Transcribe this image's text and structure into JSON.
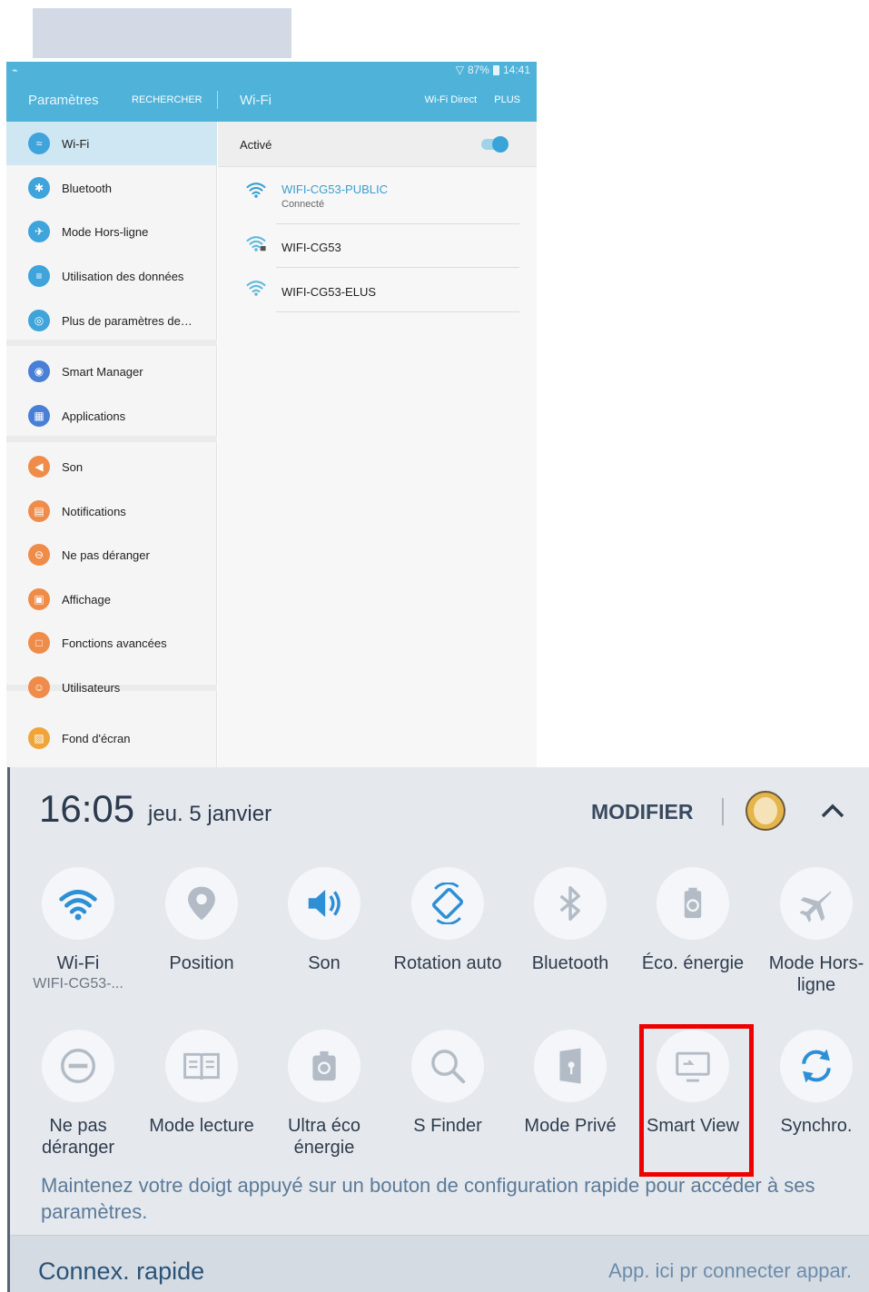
{
  "settings": {
    "status": {
      "percent": "87%",
      "time": "14:41"
    },
    "header": {
      "title": "Paramètres",
      "search": "RECHERCHER",
      "section": "Wi-Fi",
      "wifi_direct": "Wi-Fi Direct",
      "plus": "PLUS"
    },
    "sidebar": {
      "items": [
        {
          "label": "Wi-Fi",
          "icon": "wifi-icon",
          "color": "#3fa4db",
          "active": true
        },
        {
          "label": "Bluetooth",
          "icon": "bluetooth-icon",
          "color": "#3fa4db"
        },
        {
          "label": "Mode Hors-ligne",
          "icon": "airplane-icon",
          "color": "#3fa4db"
        },
        {
          "label": "Utilisation des données",
          "icon": "data-usage-icon",
          "color": "#3fa4db"
        },
        {
          "label": "Plus de paramètres de…",
          "icon": "antenna-icon",
          "color": "#3fa4db"
        },
        {
          "label": "Smart Manager",
          "icon": "smart-manager-icon",
          "color": "#4a7fd6"
        },
        {
          "label": "Applications",
          "icon": "apps-icon",
          "color": "#4a7fd6"
        },
        {
          "label": "Son",
          "icon": "sound-icon",
          "color": "#ef8c4a"
        },
        {
          "label": "Notifications",
          "icon": "notifications-icon",
          "color": "#ef8c4a"
        },
        {
          "label": "Ne pas déranger",
          "icon": "do-not-disturb-icon",
          "color": "#ef8c4a"
        },
        {
          "label": "Affichage",
          "icon": "display-icon",
          "color": "#ef8c4a"
        },
        {
          "label": "Fonctions avancées",
          "icon": "advanced-features-icon",
          "color": "#ef8c4a"
        },
        {
          "label": "Utilisateurs",
          "icon": "users-icon",
          "color": "#ef8c4a"
        },
        {
          "label": "Fond d'écran",
          "icon": "wallpaper-icon",
          "color": "#f0a53a"
        }
      ]
    },
    "wifi": {
      "toggle_label": "Activé",
      "networks": [
        {
          "name": "WIFI-CG53-PUBLIC",
          "status": "Connecté",
          "secured": false
        },
        {
          "name": "WIFI-CG53",
          "status": "",
          "secured": true
        },
        {
          "name": "WIFI-CG53-ELUS",
          "status": "",
          "secured": false
        }
      ]
    }
  },
  "quick_panel": {
    "time": "16:05",
    "date": "jeu. 5 janvier",
    "modifier": "MODIFIER",
    "tiles": [
      {
        "label": "Wi-Fi",
        "sub": "WIFI-CG53-...",
        "icon": "wifi-icon",
        "active": true
      },
      {
        "label": "Position",
        "icon": "location-icon"
      },
      {
        "label": "Son",
        "icon": "sound-icon",
        "active": true
      },
      {
        "label": "Rotation auto",
        "icon": "rotation-icon",
        "active": true
      },
      {
        "label": "Bluetooth",
        "icon": "bluetooth-icon"
      },
      {
        "label": "Éco. énergie",
        "icon": "battery-saver-icon"
      },
      {
        "label": "Mode Hors-ligne",
        "icon": "airplane-icon"
      },
      {
        "label": "Ne pas déranger",
        "icon": "do-not-disturb-icon"
      },
      {
        "label": "Mode lecture",
        "icon": "reading-mode-icon"
      },
      {
        "label": "Ultra éco énergie",
        "icon": "ultra-power-saving-icon"
      },
      {
        "label": "S Finder",
        "icon": "search-icon"
      },
      {
        "label": "Mode Privé",
        "icon": "private-mode-icon"
      },
      {
        "label": "Smart View",
        "icon": "smart-view-icon",
        "highlighted": true
      },
      {
        "label": "Synchro.",
        "icon": "sync-icon",
        "active": true
      }
    ],
    "hint": "Maintenez votre doigt appuyé sur un bouton de configuration rapide pour accéder à ses paramètres.",
    "footer_title": "Connex. rapide",
    "footer_hint": "App. ici pr connecter appar.",
    "colors": {
      "active_icon": "#2d8fd5",
      "inactive_icon": "#b3bcc6",
      "highlight": "#ee0000"
    }
  }
}
